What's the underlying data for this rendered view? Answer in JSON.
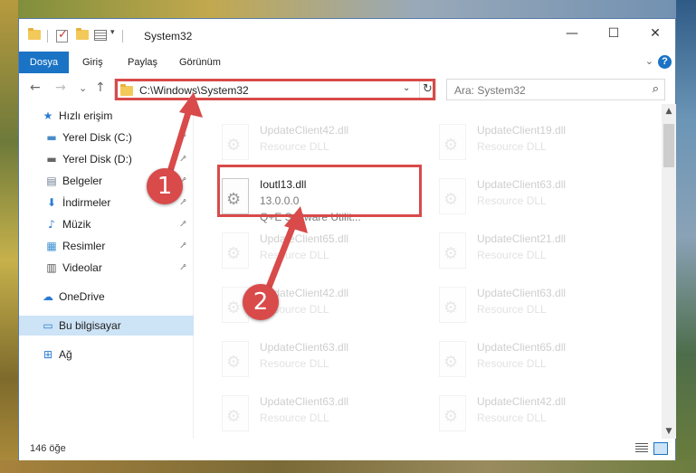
{
  "window": {
    "title": "System32",
    "controls": {
      "minimize": "—",
      "maximize": "☐",
      "close": "✕"
    }
  },
  "ribbon": {
    "tabs": [
      "Dosya",
      "Giriş",
      "Paylaş",
      "Görünüm"
    ],
    "collapse_icon": "⌄",
    "help_icon": "?"
  },
  "nav": {
    "back": "←",
    "forward": "→",
    "recent": "⌄",
    "up": "↑",
    "address": "C:\\Windows\\System32",
    "search_placeholder": "Ara: System32"
  },
  "sidebar": {
    "items": [
      {
        "label": "Hızlı erişim",
        "icon": "star-icon",
        "glyph": "★",
        "color": "#2c7bd3"
      },
      {
        "label": "Yerel Disk (C:)",
        "icon": "drive-icon",
        "glyph": "▬",
        "color": "#4a8cc9",
        "pinned": true
      },
      {
        "label": "Yerel Disk (D:)",
        "icon": "drive-icon",
        "glyph": "▬",
        "color": "#666666",
        "pinned": true
      },
      {
        "label": "Belgeler",
        "icon": "documents-icon",
        "glyph": "▤",
        "color": "#6b7c93",
        "pinned": true
      },
      {
        "label": "İndirmeler",
        "icon": "download-icon",
        "glyph": "⬇",
        "color": "#2c7bd3",
        "pinned": true
      },
      {
        "label": "Müzik",
        "icon": "music-icon",
        "glyph": "♪",
        "color": "#2c7bd3",
        "pinned": true
      },
      {
        "label": "Resimler",
        "icon": "pictures-icon",
        "glyph": "▦",
        "color": "#3d8fd1",
        "pinned": true
      },
      {
        "label": "Videolar",
        "icon": "video-icon",
        "glyph": "▥",
        "color": "#555555",
        "pinned": true
      },
      {
        "label": "OneDrive",
        "icon": "cloud-icon",
        "glyph": "☁",
        "color": "#2c7bd3"
      },
      {
        "label": "Bu bilgisayar",
        "icon": "computer-icon",
        "glyph": "▭",
        "color": "#2c7bd3",
        "selected": true
      },
      {
        "label": "Ağ",
        "icon": "network-icon",
        "glyph": "⊞",
        "color": "#2c7bd3"
      }
    ],
    "pin_glyph": "📌"
  },
  "files": [
    {
      "name": "UpdateClient42.dll",
      "desc": "Resource DLL",
      "faded": true
    },
    {
      "name": "UpdateClient19.dll",
      "desc": "Resource DLL",
      "faded": true
    },
    {
      "name": "Ioutl13.dll",
      "desc": "13.0.0.0",
      "desc2": "Q+E Software Utilit...",
      "faded": false
    },
    {
      "name": "UpdateClient63.dll",
      "desc": "Resource DLL",
      "faded": true
    },
    {
      "name": "UpdateClient65.dll",
      "desc": "Resource DLL",
      "faded": true
    },
    {
      "name": "UpdateClient21.dll",
      "desc": "Resource DLL",
      "faded": true
    },
    {
      "name": "UpdateClient42.dll",
      "desc": "Resource DLL",
      "faded": true
    },
    {
      "name": "UpdateClient63.dll",
      "desc": "Resource DLL",
      "faded": true
    },
    {
      "name": "UpdateClient63.dll",
      "desc": "Resource DLL",
      "faded": true
    },
    {
      "name": "UpdateClient65.dll",
      "desc": "Resource DLL",
      "faded": true
    },
    {
      "name": "UpdateClient63.dll",
      "desc": "Resource DLL",
      "faded": true
    },
    {
      "name": "UpdateClient42.dll",
      "desc": "Resource DLL",
      "faded": true
    }
  ],
  "status": {
    "count": "146 öğe"
  },
  "annotations": {
    "step1": "1",
    "step2": "2",
    "color": "#d94a4a"
  }
}
